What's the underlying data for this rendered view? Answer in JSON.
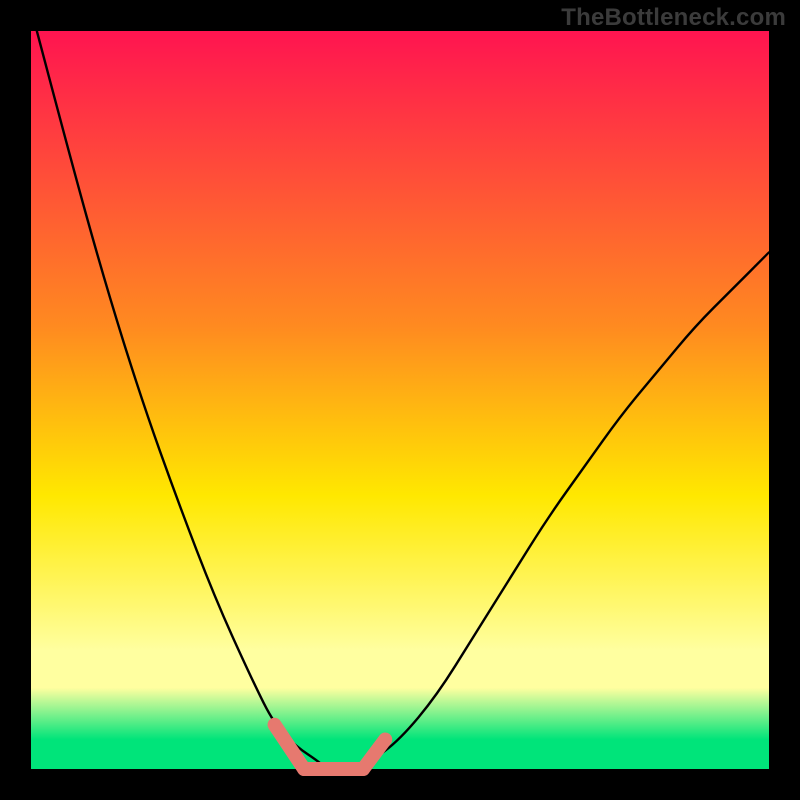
{
  "watermark": "TheBottleneck.com",
  "colors": {
    "background": "#000000",
    "watermark_text": "#3b3b3b",
    "gradient_top": "#ff1450",
    "gradient_orange": "#ff8a20",
    "gradient_yellow": "#ffe800",
    "gradient_pale": "#ffffa0",
    "gradient_green": "#00e47a",
    "curve": "#000000",
    "marker": "#e6796f"
  },
  "chart_data": {
    "type": "line",
    "title": "",
    "xlabel": "",
    "ylabel": "",
    "xlim": [
      0,
      100
    ],
    "ylim": [
      0,
      100
    ],
    "series": [
      {
        "name": "bottleneck-curve",
        "x": [
          0,
          5,
          10,
          15,
          20,
          25,
          30,
          33,
          36,
          39,
          40,
          42,
          44,
          46,
          50,
          55,
          60,
          65,
          70,
          75,
          80,
          85,
          90,
          95,
          100
        ],
        "y": [
          103,
          84,
          66,
          50,
          36,
          23,
          12,
          6,
          3,
          1,
          0,
          0,
          0,
          1,
          4,
          10,
          18,
          26,
          34,
          41,
          48,
          54,
          60,
          65,
          70
        ]
      }
    ],
    "markers": [
      {
        "name": "flat-region",
        "x_range": [
          37,
          45
        ],
        "y": 0
      },
      {
        "name": "left-rise",
        "x_range": [
          33,
          37
        ],
        "y_range": [
          0,
          6
        ]
      },
      {
        "name": "right-rise",
        "x_range": [
          45,
          48
        ],
        "y_range": [
          0,
          4
        ]
      }
    ],
    "gradient_stops_pct": [
      {
        "pos": 0,
        "meaning": "worst",
        "color_key": "gradient_top"
      },
      {
        "pos": 40,
        "meaning": "bad",
        "color_key": "gradient_orange"
      },
      {
        "pos": 63,
        "meaning": "ok",
        "color_key": "gradient_yellow"
      },
      {
        "pos": 84,
        "meaning": "pale",
        "color_key": "gradient_pale"
      },
      {
        "pos": 96,
        "meaning": "best",
        "color_key": "gradient_green"
      }
    ]
  }
}
